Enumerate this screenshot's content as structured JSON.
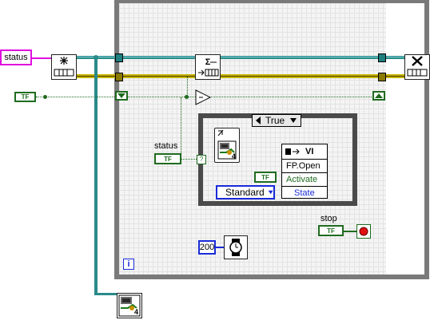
{
  "controls": {
    "status_terminal_label": "status",
    "inner_status_label": "status",
    "stop_label": "stop",
    "bool_left": "TF",
    "bool_status": "TF",
    "bool_true_const": "TF",
    "bool_stop": "TF"
  },
  "case_structure": {
    "selector_value": "True",
    "property_node": {
      "class": "VI",
      "row1": "FP.Open",
      "row2": "Activate",
      "row3": "State"
    },
    "enum_value": "Standard"
  },
  "wait_ms_value": "200",
  "loop_iteration_label": "i",
  "icon_number": "4",
  "colors": {
    "loop_frame": "#7a7a7a",
    "string_wire": "#e010e0",
    "boolean_wire": "#1f6b1f",
    "refnum_wire": "#1f7f7f",
    "cluster_wire": "#8a7a00",
    "numeric_wire": "#1a2ad8"
  }
}
